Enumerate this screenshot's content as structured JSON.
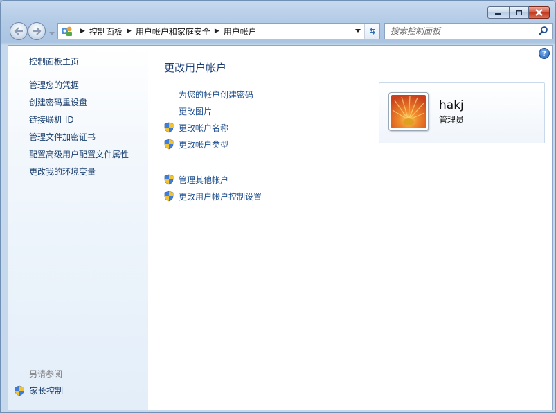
{
  "window": {
    "controls": {
      "minimize_icon": "minimize-icon",
      "maximize_icon": "maximize-icon",
      "close_icon": "close-icon"
    }
  },
  "navbar": {
    "breadcrumb": [
      "控制面板",
      "用户帐户和家庭安全",
      "用户帐户"
    ],
    "search": {
      "placeholder": "搜索控制面板"
    }
  },
  "sidebar": {
    "home": "控制面板主页",
    "links": [
      "管理您的凭据",
      "创建密码重设盘",
      "链接联机 ID",
      "管理文件加密证书",
      "配置高级用户配置文件属性",
      "更改我的环境变量"
    ],
    "see_also": "另请参阅",
    "parental_control": "家长控制"
  },
  "main": {
    "title": "更改用户帐户",
    "tasks": [
      {
        "label": "为您的帐户创建密码",
        "shield": false
      },
      {
        "label": "更改图片",
        "shield": false
      },
      {
        "label": "更改帐户名称",
        "shield": true
      },
      {
        "label": "更改帐户类型",
        "shield": true
      }
    ],
    "other_tasks": [
      {
        "label": "管理其他帐户",
        "shield": true
      },
      {
        "label": "更改用户帐户控制设置",
        "shield": true
      }
    ]
  },
  "user": {
    "name": "hakj",
    "role": "管理员"
  },
  "help": {
    "label": "?"
  },
  "colors": {
    "link": "#1e4f8f",
    "title": "#1e3f78",
    "sidebar_link": "#1b3f6e",
    "close": "#c23a20"
  }
}
